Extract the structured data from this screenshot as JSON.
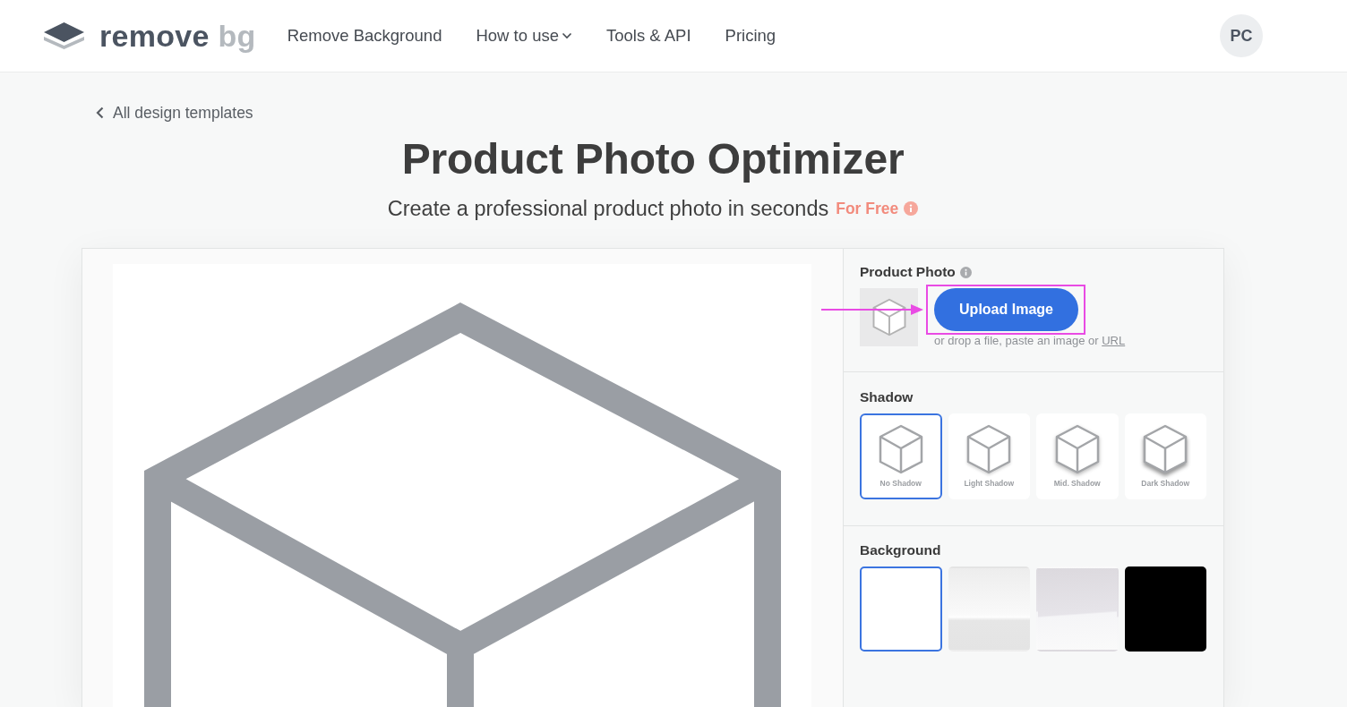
{
  "header": {
    "logo": {
      "name": "remove",
      "accent": "bg"
    },
    "nav": [
      {
        "label": "Remove Background",
        "has_menu": false
      },
      {
        "label": "How to use",
        "has_menu": true
      },
      {
        "label": "Tools & API",
        "has_menu": false
      },
      {
        "label": "Pricing",
        "has_menu": false
      }
    ],
    "avatar": {
      "initials": "PC"
    }
  },
  "back_link": {
    "label": "All design templates"
  },
  "hero": {
    "title": "Product Photo Optimizer",
    "subtitle": "Create a professional product photo in seconds",
    "badge": "For Free"
  },
  "editor": {
    "product_photo": {
      "label": "Product Photo",
      "button": {
        "label": "Upload Image",
        "highlighted": true
      },
      "hint": "or drop a file, paste an image or",
      "hint_link": "URL"
    },
    "shadow": {
      "label": "Shadow",
      "options": [
        {
          "label": "No Shadow",
          "kind": "none",
          "selected": true
        },
        {
          "label": "Light Shadow",
          "kind": "light",
          "selected": false
        },
        {
          "label": "Mid. Shadow",
          "kind": "mid",
          "selected": false
        },
        {
          "label": "Dark Shadow",
          "kind": "dark",
          "selected": false
        }
      ]
    },
    "background": {
      "label": "Background",
      "options": [
        {
          "kind": "white",
          "selected": true
        },
        {
          "kind": "gradient",
          "selected": false
        },
        {
          "kind": "studio",
          "selected": false
        },
        {
          "kind": "black",
          "selected": false
        }
      ]
    }
  }
}
